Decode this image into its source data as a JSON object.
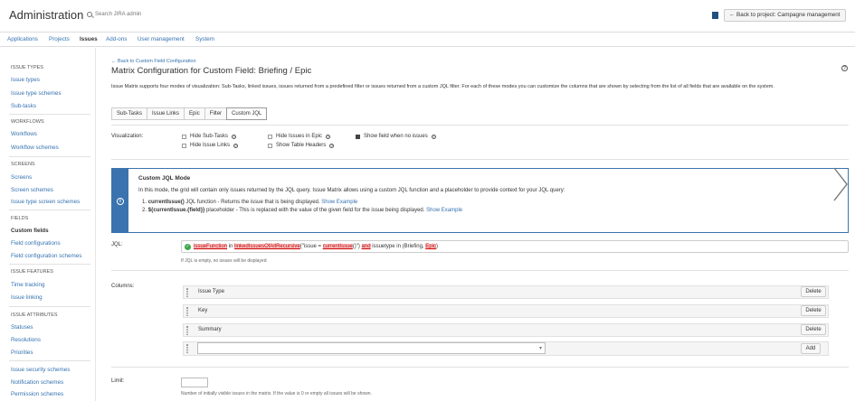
{
  "header": {
    "title": "Administration",
    "search_placeholder": "Search JIRA admin",
    "back_label": "← Back to project: Campagne management"
  },
  "nav": {
    "items": [
      {
        "label": "Applications"
      },
      {
        "label": "Projects"
      },
      {
        "label": "Issues",
        "active": true
      },
      {
        "label": "Add-ons"
      },
      {
        "label": "User management"
      },
      {
        "label": "System"
      }
    ]
  },
  "sidebar": {
    "sections": [
      {
        "heading": "ISSUE TYPES",
        "items": [
          "Issue types",
          "Issue type schemes",
          "Sub-tasks"
        ]
      },
      {
        "heading": "WORKFLOWS",
        "items": [
          "Workflows",
          "Workflow schemes"
        ]
      },
      {
        "heading": "SCREENS",
        "items": [
          "Screens",
          "Screen schemes",
          "Issue type screen schemes"
        ]
      },
      {
        "heading": "FIELDS",
        "items": [
          "Custom fields",
          "Field configurations",
          "Field configuration schemes"
        ]
      },
      {
        "heading": "ISSUE FEATURES",
        "items": [
          "Time tracking",
          "Issue linking"
        ]
      },
      {
        "heading": "ISSUE ATTRIBUTES",
        "items": [
          "Statuses",
          "Resolutions",
          "Priorities"
        ]
      },
      {
        "heading": "",
        "items": [
          "Issue security schemes",
          "Notification schemes",
          "Permission schemes"
        ]
      }
    ],
    "current_item": "Custom fields"
  },
  "page": {
    "back_link": "← Back to Custom Field Configuration",
    "title": "Matrix Configuration for Custom Field: Briefing / Epic",
    "description": "Issue Matrix supports four modes of visualization: Sub-Tasks, linked issues, issues returned from a predefined filter or issues returned from a custom JQL filter. For each of these modes you can customize the columns that are shown by selecting from the list of all fields that are available on the system.",
    "tabs": [
      {
        "label": "Sub-Tasks"
      },
      {
        "label": "Issue Links"
      },
      {
        "label": "Epic"
      },
      {
        "label": "Filter"
      },
      {
        "label": "Custom JQL",
        "selected": true
      }
    ]
  },
  "visualization": {
    "label": "Visualization:",
    "options": [
      {
        "label": "Hide Sub-Tasks",
        "checked": false
      },
      {
        "label": "Hide Issues in Epic",
        "checked": false
      },
      {
        "label": "Show field when no issues",
        "checked": true
      },
      {
        "label": "Hide Issue Links",
        "checked": false
      },
      {
        "label": "Show Table Headers",
        "checked": false
      }
    ]
  },
  "info": {
    "heading": "Custom JQL Mode",
    "intro": "In this mode, the grid will contain only issues returned by the JQL query. Issue Matrix allows using a custom JQL function and a placeholder to provide context for your JQL query:",
    "item1_num": "1.",
    "item1_bold": "currentIssue()",
    "item1_text": " JQL function - Returns the issue that is being displayed.",
    "item2_num": "2.",
    "item2_bold": "${currentIssue.{field}}",
    "item2_text": " placeholder - This is replaced with the value of the given field for the issue being displayed.",
    "show_example": "Show Example"
  },
  "jql": {
    "label": "JQL:",
    "part1": "issueFunction",
    "part2": " in ",
    "part3": "linkedIssuesOfAllRecursive",
    "part4": "(\"issue = ",
    "part5": "currentIssue",
    "part6": "()\") ",
    "part7": "and",
    "part8": " issuetype in (Briefing, ",
    "part9": "Epic",
    "part10": ")",
    "hint": "If JQL is empty, no issues will be displayed"
  },
  "columns": {
    "label": "Columns:",
    "items": [
      "Issue Type",
      "Key",
      "Summary"
    ],
    "delete_label": "Delete",
    "add_label": "Add",
    "select_caret": "▾"
  },
  "limit": {
    "label": "Limit:",
    "value": "",
    "hint": "Number of initially visible issues in the matrix. If the value is 0 or empty all issues will be shown."
  },
  "colors": {
    "link": "#3572b0",
    "info_blue": "#3b73af",
    "check_green": "#3ba74a"
  }
}
